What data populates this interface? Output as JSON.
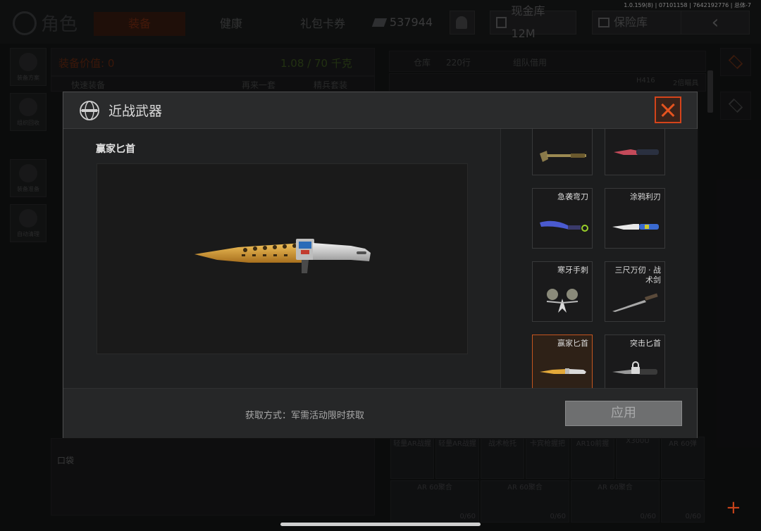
{
  "status": {
    "version": "1.0.159(8) | 07101158 | 7642192776 | 总体-7"
  },
  "header": {
    "title": "角色",
    "tabs": [
      {
        "label": "装备",
        "active": true
      },
      {
        "label": "健康",
        "active": false
      },
      {
        "label": "礼包卡券",
        "active": false
      }
    ],
    "currency": "537944",
    "vault": "现金库 12M",
    "insurance": "保险库"
  },
  "left_nav": [
    {
      "label": "装备方案"
    },
    {
      "label": "组织回收"
    },
    {
      "label": "装备准备"
    },
    {
      "label": "自动清理"
    }
  ],
  "equipment": {
    "value_label": "装备价值: 0",
    "weight": "1.08 / 70 千克",
    "quick_equip": "快速装备",
    "again": "再来一套",
    "preset": "精兵套装",
    "pocket": "口袋"
  },
  "warehouse": {
    "tab_warehouse": "仓库",
    "rows": "220行",
    "tab_team": "组队借用",
    "item_h416": "H416",
    "item_scope": "2倍瞄具",
    "bottom_items": [
      "轻量AR战握",
      "轻量AR战握",
      "战术枪托",
      "卡宾枪握把",
      "AR10前握",
      "X300U",
      "AR 60弹"
    ],
    "mags": [
      "AR 60聚合",
      "AR 60聚合",
      "AR 60聚合"
    ],
    "mag_counts": [
      "0/60",
      "0/60",
      "0/60",
      "0/60"
    ]
  },
  "modal": {
    "title": "近战武器",
    "selected_name": "赢家匕首",
    "acquire_text": "获取方式：军需活动限时获取",
    "apply_label": "应用",
    "items": [
      {
        "name": "",
        "kind": "shovel"
      },
      {
        "name": "",
        "kind": "knife-red"
      },
      {
        "name": "急袭弯刀",
        "kind": "karambit"
      },
      {
        "name": "涂鸦利刃",
        "kind": "knife-graffiti"
      },
      {
        "name": "寒牙手刺",
        "kind": "claws"
      },
      {
        "name": "三尺万仞 · 战术剑",
        "kind": "sword"
      },
      {
        "name": "赢家匕首",
        "kind": "gold-knife",
        "selected": true
      },
      {
        "name": "突击匕首",
        "kind": "locked-knife",
        "locked": true
      }
    ]
  },
  "colors": {
    "accent": "#d4441b",
    "gold": "#d9a53a"
  }
}
